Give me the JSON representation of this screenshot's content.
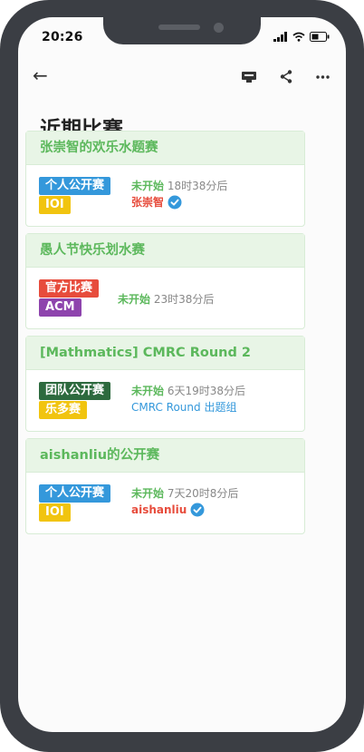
{
  "status_bar": {
    "time": "20:26"
  },
  "page": {
    "title": "近期比赛"
  },
  "colors": {
    "green": "#5cb85c",
    "blue_tag": "#3498db",
    "yellow_tag": "#f1c40f",
    "red_tag": "#e74c3c",
    "purple_tag": "#8e44ad",
    "dark_green_tag": "#2d6a3e"
  },
  "contests": [
    {
      "title": "张崇智的欢乐水题赛",
      "tags": [
        {
          "label": "个人公开赛",
          "color": "#3498db"
        },
        {
          "label": "IOI",
          "color": "#f1c40f"
        }
      ],
      "status": "未开始",
      "remaining": "18时38分后",
      "author": "张崇智",
      "verified": true
    },
    {
      "title": "愚人节快乐划水赛",
      "tags": [
        {
          "label": "官方比赛",
          "color": "#e74c3c"
        },
        {
          "label": "ACM",
          "color": "#8e44ad"
        }
      ],
      "status": "未开始",
      "remaining": "23时38分后",
      "author": "",
      "verified": false
    },
    {
      "title": "[Mathmatics] CMRC Round 2",
      "tags": [
        {
          "label": "团队公开赛",
          "color": "#2d6a3e"
        },
        {
          "label": "乐多赛",
          "color": "#f1c40f"
        }
      ],
      "status": "未开始",
      "remaining": "6天19时38分后",
      "author": "CMRC Round 出题组",
      "verified": false
    },
    {
      "title": "aishanliu的公开赛",
      "tags": [
        {
          "label": "个人公开赛",
          "color": "#3498db"
        },
        {
          "label": "IOI",
          "color": "#f1c40f"
        }
      ],
      "status": "未开始",
      "remaining": "7天20时8分后",
      "author": "aishanliu",
      "verified": true
    }
  ]
}
